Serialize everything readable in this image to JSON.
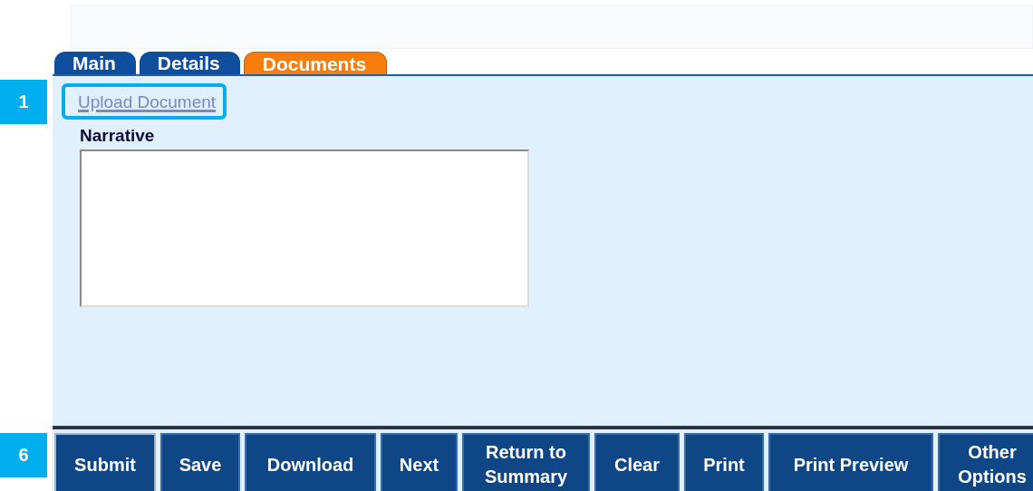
{
  "tabs": [
    {
      "label": "Main",
      "selected": false
    },
    {
      "label": "Details",
      "selected": false
    },
    {
      "label": "Documents",
      "selected": true
    }
  ],
  "upload_link": {
    "label": "Upload Document",
    "highlighted": true,
    "callout": "1"
  },
  "narrative": {
    "label": "Narrative"
  },
  "toolbar": {
    "callout": "6",
    "buttons": [
      {
        "label": "Submit",
        "focused": true
      },
      {
        "label": "Save",
        "focused": false
      },
      {
        "label": "Download",
        "focused": false
      },
      {
        "label": "Next",
        "focused": false
      },
      {
        "label": "Return to Summary",
        "focused": false
      },
      {
        "label": "Clear",
        "focused": false
      },
      {
        "label": "Print",
        "focused": false
      },
      {
        "label": "Print Preview",
        "focused": false
      },
      {
        "label": "Other Options",
        "focused": false
      }
    ]
  }
}
